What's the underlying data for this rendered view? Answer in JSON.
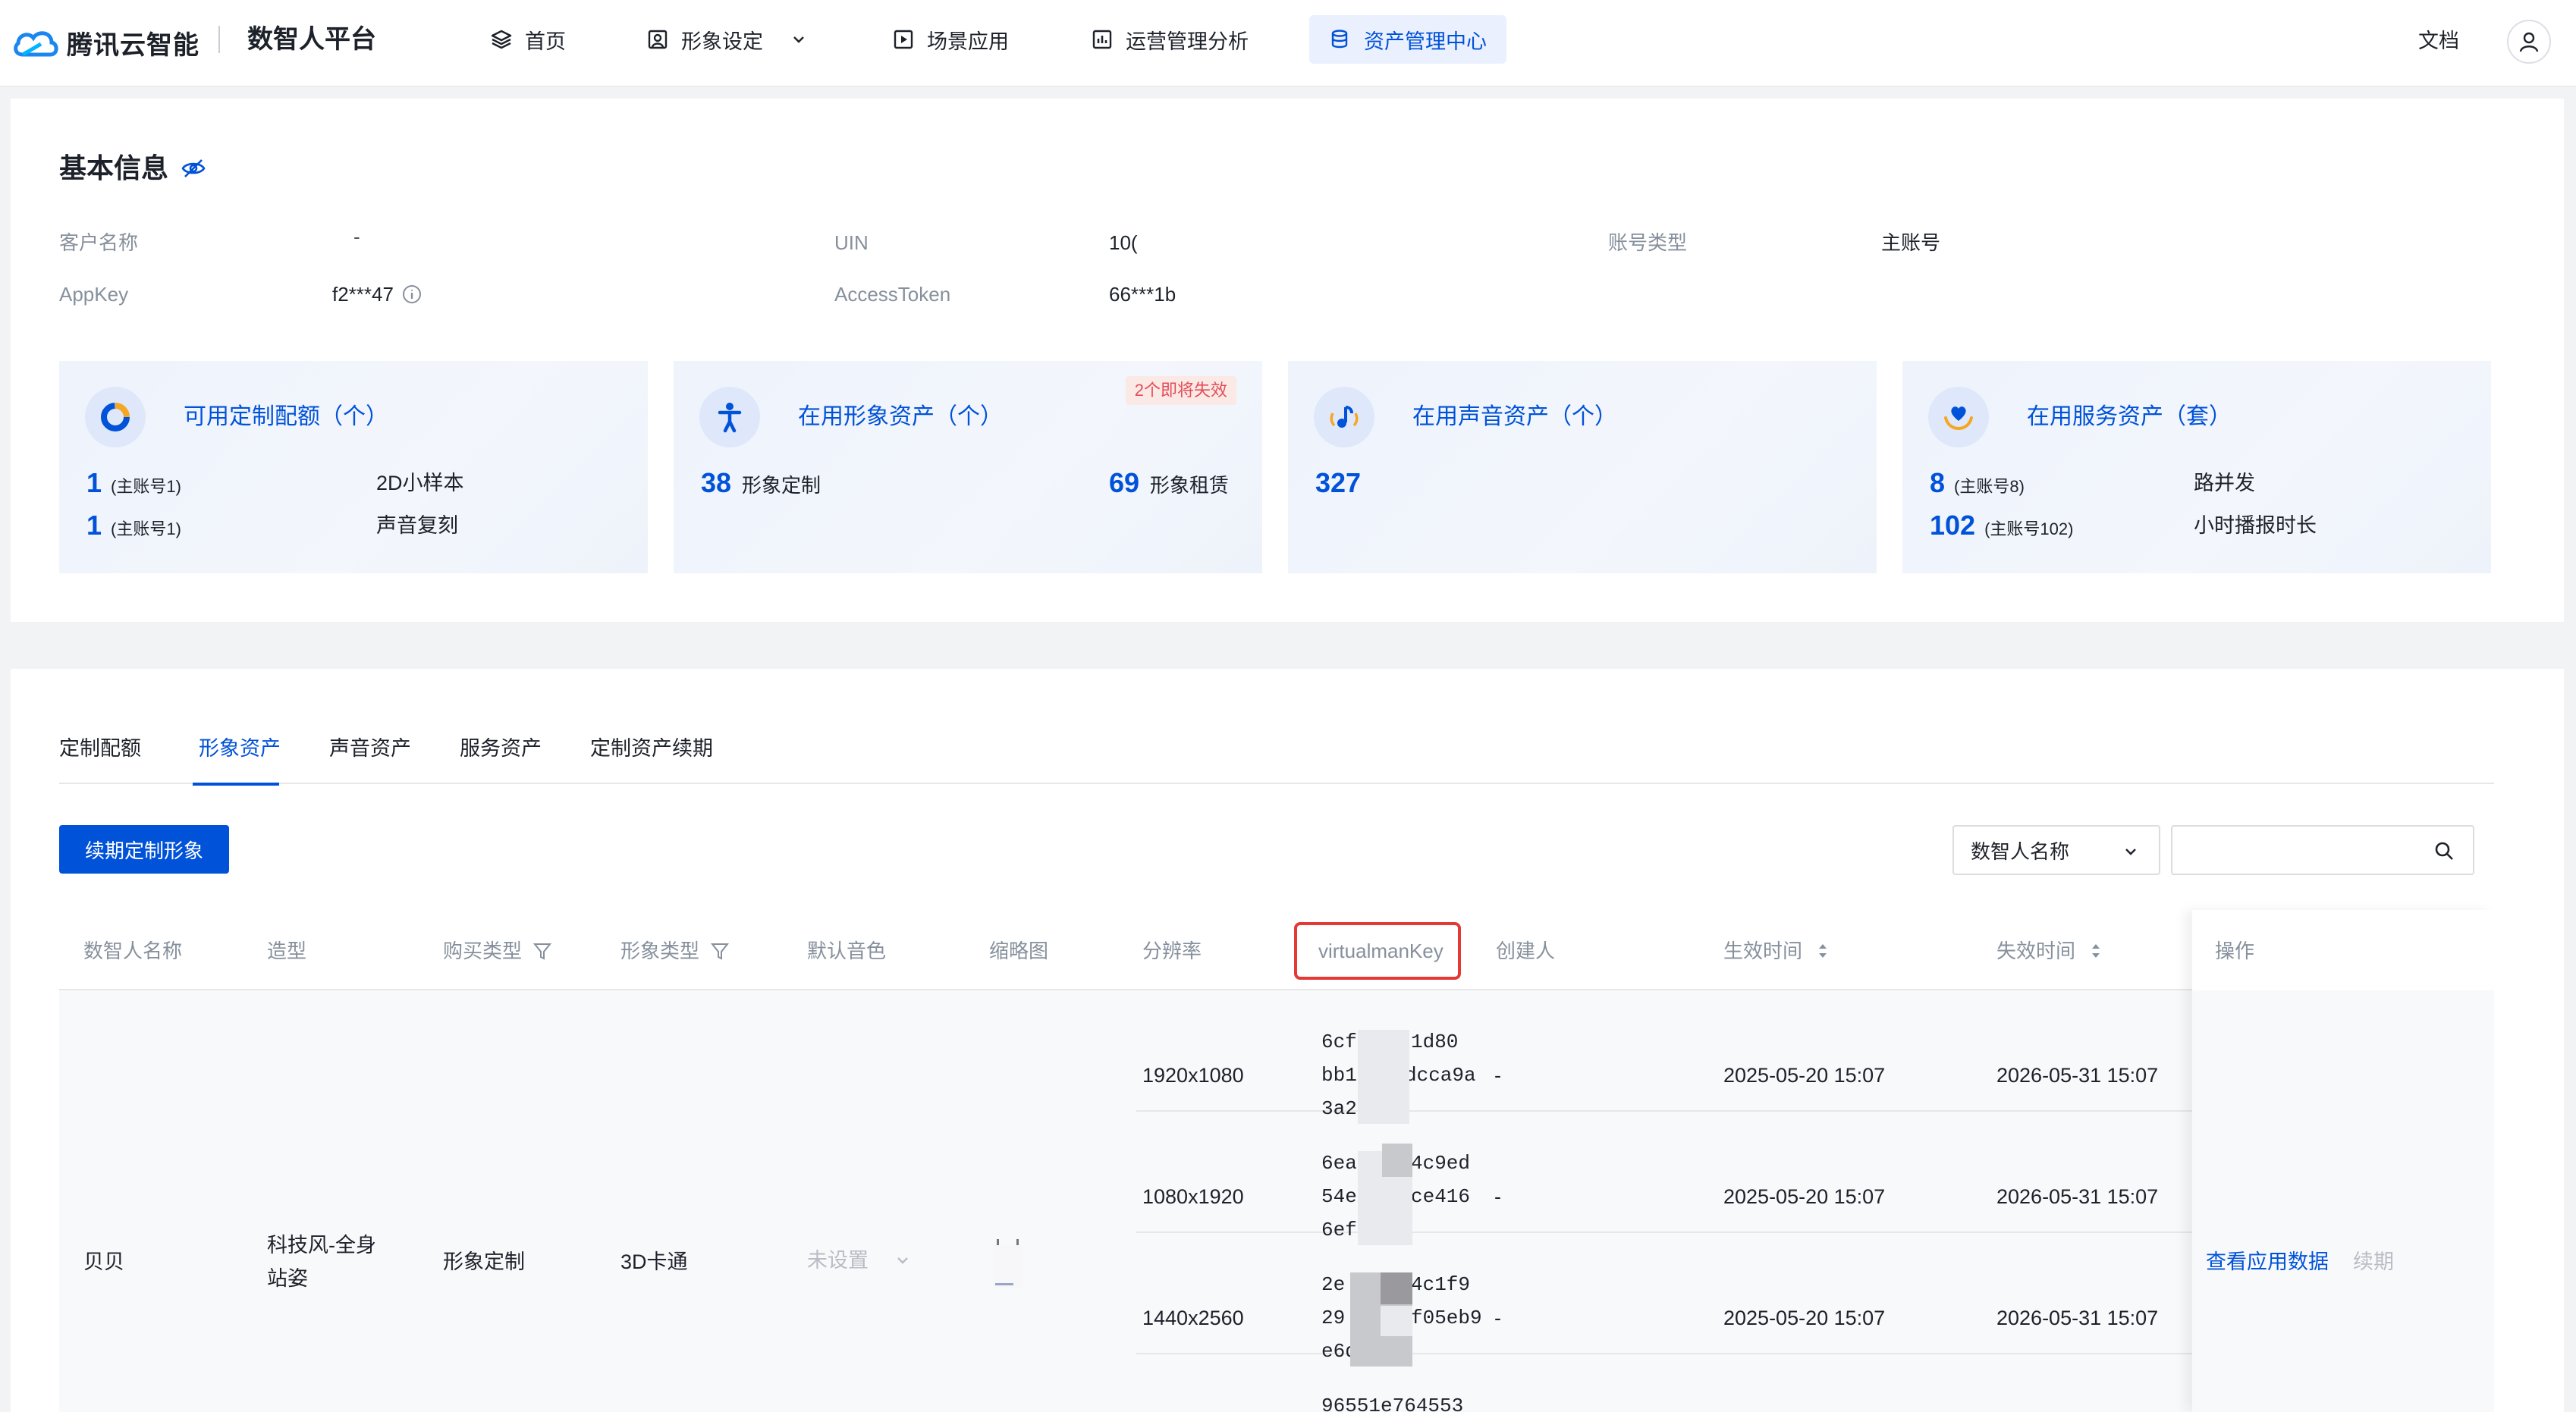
{
  "nav": {
    "logo_text": "腾讯云智能",
    "platform": "数智人平台",
    "items": [
      {
        "label": "首页",
        "icon": "layers-icon"
      },
      {
        "label": "形象设定",
        "icon": "portrait-icon"
      },
      {
        "label": "场景应用",
        "icon": "play-square-icon"
      },
      {
        "label": "运营管理分析",
        "icon": "chart-icon"
      },
      {
        "label": "资产管理中心",
        "icon": "database-icon",
        "active": true
      }
    ],
    "doc_label": "文档"
  },
  "basic_info": {
    "title": "基本信息",
    "fields": [
      {
        "label": "客户名称",
        "value": "-"
      },
      {
        "label": "UIN",
        "value": "10("
      },
      {
        "label": "账号类型",
        "value": "主账号"
      },
      {
        "label": "AppKey",
        "value": "f2***47"
      },
      {
        "label": "AccessToken",
        "value": "66***1b"
      }
    ]
  },
  "stats": [
    {
      "title": "可用定制配额（个）",
      "icon": "pie-chart-icon",
      "rows": [
        {
          "value": "1",
          "sub": "(主账号1)",
          "desc": "2D小样本"
        },
        {
          "value": "1",
          "sub": "(主账号1)",
          "desc": "声音复刻"
        }
      ]
    },
    {
      "title": "在用形象资产（个）",
      "icon": "person-icon",
      "tag": "2个即将失效",
      "items": [
        {
          "value": "38",
          "desc": "形象定制"
        },
        {
          "value": "69",
          "desc": "形象租赁"
        }
      ]
    },
    {
      "title": "在用声音资产（个）",
      "icon": "music-icon",
      "value": "327"
    },
    {
      "title": "在用服务资产（套）",
      "icon": "heart-hand-icon",
      "rows": [
        {
          "value": "8",
          "sub": "(主账号8)",
          "desc": "路并发"
        },
        {
          "value": "102",
          "sub": "(主账号102)",
          "desc": "小时播报时长"
        }
      ]
    }
  ],
  "tabs": [
    "定制配额",
    "形象资产",
    "声音资产",
    "服务资产",
    "定制资产续期"
  ],
  "active_tab": "形象资产",
  "toolbar": {
    "renew_button": "续期定制形象",
    "select_value": "数智人名称",
    "search_placeholder": ""
  },
  "table": {
    "columns": [
      "数智人名称",
      "造型",
      "购买类型",
      "形象类型",
      "默认音色",
      "缩略图",
      "分辨率",
      "virtualmanKey",
      "创建人",
      "生效时间",
      "失效时间",
      "操作"
    ],
    "row": {
      "name": "贝贝",
      "style_line1": "科技风-全身",
      "style_line2": "站姿",
      "purchase_type": "形象定制",
      "avatar_type": "3D卡通",
      "voice": "未设置",
      "actions": [
        "查看应用数据",
        "续期"
      ],
      "subrows": [
        {
          "resolution": "1920x1080",
          "key_lines": [
            "6cf",
            "bb1",
            "3a2"
          ],
          "key_tail": [
            "1d80",
            "dcca9a",
            ""
          ],
          "creator": "-",
          "start": "2025-05-20 15:07",
          "end": "2026-05-31 15:07"
        },
        {
          "resolution": "1080x1920",
          "key_lines": [
            "6ea",
            "54e",
            "6ef"
          ],
          "key_tail": [
            "4c9ed",
            "ce416",
            ""
          ],
          "creator": "-",
          "start": "2025-05-20 15:07",
          "end": "2026-05-31 15:07"
        },
        {
          "resolution": "1440x2560",
          "key_lines": [
            "2e",
            "29",
            "e6d"
          ],
          "key_tail": [
            "4c1f9",
            "f05eb9",
            ""
          ],
          "creator": "-",
          "start": "2025-05-20 15:07",
          "end": "2026-05-31 15:07"
        }
      ],
      "next_key_partial": "96551e764553"
    }
  },
  "colors": {
    "primary": "#0052d9",
    "warn": "#e34d59",
    "highlight_border": "#e53935"
  }
}
